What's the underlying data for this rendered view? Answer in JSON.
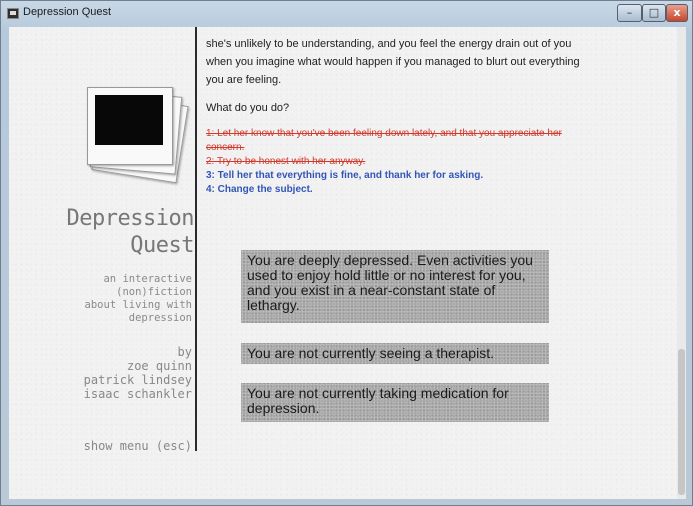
{
  "window": {
    "title": "Depression Quest",
    "controls": {
      "minimize": "–",
      "maximize": "□",
      "close": "x"
    }
  },
  "sidebar": {
    "title_line1": "Depression",
    "title_line2": "Quest",
    "tagline": [
      "an interactive",
      "(non)fiction",
      "about living with",
      "depression"
    ],
    "by": "by",
    "authors": [
      "zoe quinn",
      "patrick lindsey",
      "isaac schankler"
    ],
    "menu_link": "show menu (esc)"
  },
  "story": {
    "paragraph": "she's unlikely to be understanding, and you feel the energy drain out of you when you imagine what would happen if you managed to blurt out everything you are feeling.",
    "question": "What do you do?",
    "options": [
      {
        "text": "1: Let her know that you've been feeling down lately, and that you appreciate her concern.",
        "state": "unavailable"
      },
      {
        "text": "2: Try to be honest with her anyway.",
        "state": "unavailable"
      },
      {
        "text": "3: Tell her that everything is fine, and thank her for asking.",
        "state": "available"
      },
      {
        "text": "4: Change the subject.",
        "state": "available"
      }
    ]
  },
  "status": [
    "You are deeply depressed. Even activities you used to enjoy hold little or no interest for you, and you exist in a near-constant state of lethargy.",
    "You are not currently seeing a therapist.",
    "You are not currently taking medication for depression."
  ],
  "colors": {
    "unavailable": "#d0392b",
    "available": "#3355b8",
    "status_box": "#a8a8a8"
  }
}
